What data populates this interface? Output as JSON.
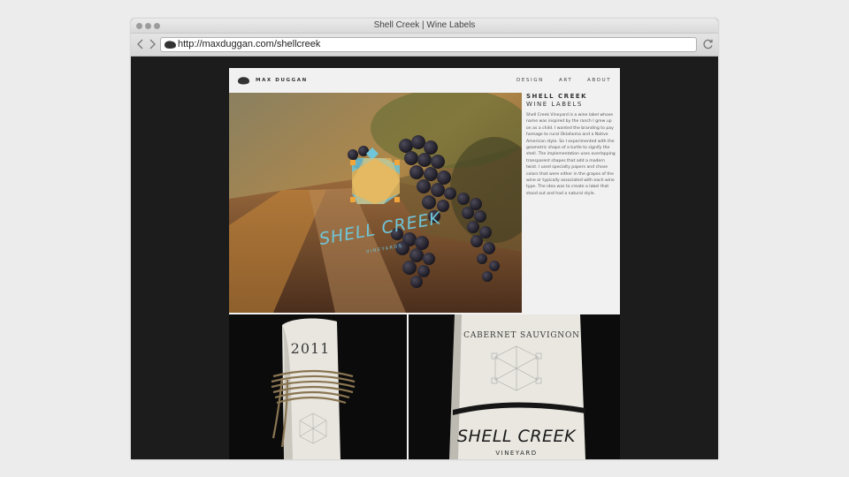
{
  "window": {
    "title": "Shell Creek | Wine Labels"
  },
  "toolbar": {
    "url": "http://maxduggan.com/shellcreek",
    "back_icon": "chevron-left-icon",
    "forward_icon": "chevron-right-icon",
    "reload_icon": "reload-icon"
  },
  "site": {
    "brand": "MAX DUGGAN",
    "nav": [
      "DESIGN",
      "ART",
      "ABOUT"
    ]
  },
  "project": {
    "title": "SHELL CREEK",
    "subtitle": "WINE LABELS",
    "description": "Shell Creek Vineyard is a wine label whose name was inspired by the ranch I grew up on as a child. I wanted the branding to pay homage to rural Oklahoma and a Native American style. So I experimented with the geometric shape of a turtle to signify the shell. The implementation uses overlapping transparent shapes that add a modern twist. I used specialty papers and chose colors that were either in the grapes of the wine or typically associated with each wine type. The idea was to create a label that stood out and had a natural style."
  },
  "hero": {
    "logo_text": "SHELL CREEK",
    "logo_subtext": "VINEYARDS"
  },
  "bottle_left": {
    "year": "2011"
  },
  "bottle_right": {
    "varietal": "CABERNET SAUVIGNON",
    "name": "SHELL CREEK",
    "sub": "VINEYARD"
  },
  "colors": {
    "accent_blue": "#6fc6d9",
    "accent_orange": "#f0a63a",
    "page_bg": "#f1f1f1",
    "dark_bg": "#1c1c1c"
  }
}
